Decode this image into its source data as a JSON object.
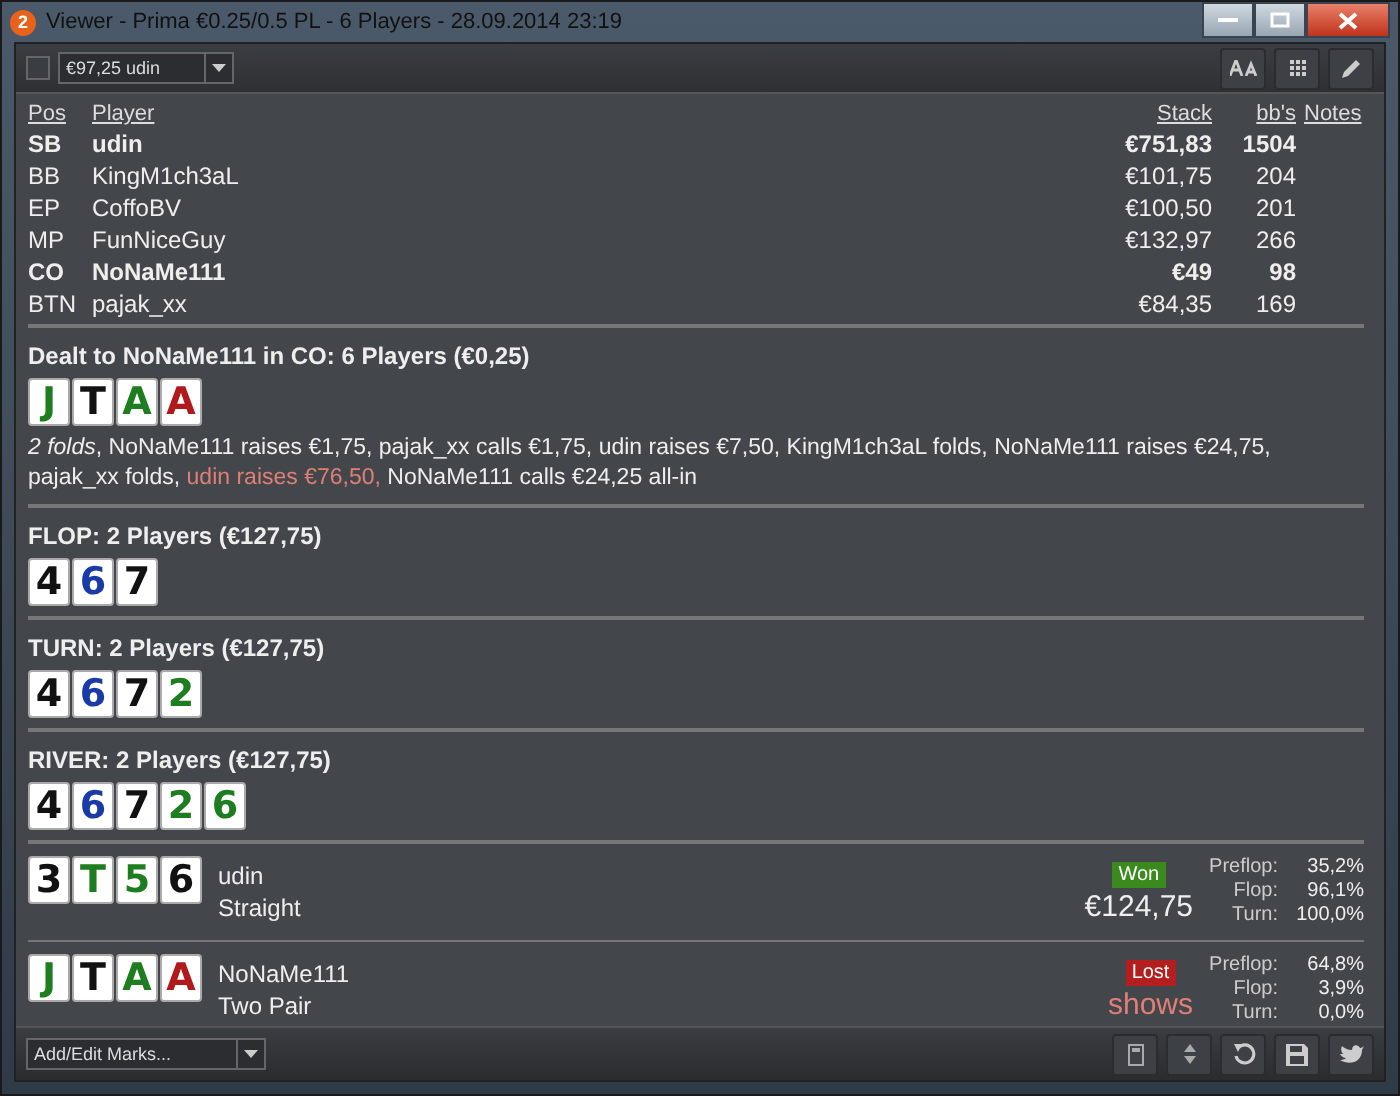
{
  "window": {
    "title": "Viewer - Prima €0.25/0.5 PL - 6 Players - 28.09.2014 23:19",
    "badge": "2"
  },
  "toolbar": {
    "checked": false,
    "hand_select": "€97,25 udin"
  },
  "players": {
    "columns": [
      "Pos",
      "Player",
      "Stack",
      "bb's",
      "Notes"
    ],
    "rows": [
      {
        "pos": "SB",
        "name": "udin",
        "stack": "€751,83",
        "bbs": "1504",
        "highlighted": true
      },
      {
        "pos": "BB",
        "name": "KingM1ch3aL",
        "stack": "€101,75",
        "bbs": "204",
        "highlighted": false
      },
      {
        "pos": "EP",
        "name": "CoffoBV",
        "stack": "€100,50",
        "bbs": "201",
        "highlighted": false
      },
      {
        "pos": "MP",
        "name": "FunNiceGuy",
        "stack": "€132,97",
        "bbs": "266",
        "highlighted": false
      },
      {
        "pos": "CO",
        "name": "NoNaMe111",
        "stack": "€49",
        "bbs": "98",
        "highlighted": true
      },
      {
        "pos": "BTN",
        "name": "pajak_xx",
        "stack": "€84,35",
        "bbs": "169",
        "highlighted": false
      }
    ]
  },
  "streets": [
    {
      "title": "Dealt to NoNaMe111 in CO: 6 Players (€0,25)",
      "cards": [
        {
          "rank": "J",
          "color": "#1e7d1e"
        },
        {
          "rank": "T",
          "color": "#111111"
        },
        {
          "rank": "A",
          "color": "#1e7d1e"
        },
        {
          "rank": "A",
          "color": "#b01a1a"
        }
      ],
      "actions": [
        {
          "text": "*2 folds*, NoNaMe111 raises €1,75, pajak_xx calls €1,75, udin raises €7,50, KingM1ch3aL folds, NoNaMe111 raises €24,75, pajak_xx folds,",
          "highlighted": false
        },
        {
          "text": "udin raises €76,50,",
          "highlighted": true
        },
        {
          "text": "NoNaMe111 calls €24,25 all-in",
          "highlighted": false
        }
      ]
    },
    {
      "title": "FLOP: 2 Players (€127,75)",
      "cards": [
        {
          "rank": "4",
          "color": "#111111"
        },
        {
          "rank": "6",
          "color": "#1a3aa8"
        },
        {
          "rank": "7",
          "color": "#111111"
        }
      ]
    },
    {
      "title": "TURN: 2 Players (€127,75)",
      "cards": [
        {
          "rank": "4",
          "color": "#111111"
        },
        {
          "rank": "6",
          "color": "#1a3aa8"
        },
        {
          "rank": "7",
          "color": "#111111"
        },
        {
          "rank": "2",
          "color": "#1e7d1e"
        }
      ]
    },
    {
      "title": "RIVER: 2 Players (€127,75)",
      "cards": [
        {
          "rank": "4",
          "color": "#111111"
        },
        {
          "rank": "6",
          "color": "#1a3aa8"
        },
        {
          "rank": "7",
          "color": "#111111"
        },
        {
          "rank": "2",
          "color": "#1e7d1e"
        },
        {
          "rank": "6",
          "color": "#1e7d1e"
        }
      ]
    }
  ],
  "showdown": [
    {
      "cards": [
        {
          "rank": "3",
          "color": "#111111"
        },
        {
          "rank": "T",
          "color": "#1e7d1e"
        },
        {
          "rank": "5",
          "color": "#1e7d1e"
        },
        {
          "rank": "6",
          "color": "#111111"
        }
      ],
      "name": "udin",
      "hand": "Straight",
      "result": {
        "kind": "won",
        "label": "Won"
      },
      "amount": "€124,75",
      "equity": [
        {
          "label": "Preflop:",
          "value": "35,2%"
        },
        {
          "label": "Flop:",
          "value": "96,1%"
        },
        {
          "label": "Turn:",
          "value": "100,0%"
        }
      ]
    },
    {
      "cards": [
        {
          "rank": "J",
          "color": "#1e7d1e"
        },
        {
          "rank": "T",
          "color": "#111111"
        },
        {
          "rank": "A",
          "color": "#1e7d1e"
        },
        {
          "rank": "A",
          "color": "#b01a1a"
        }
      ],
      "name": "NoNaMe111",
      "hand": "Two Pair",
      "result": {
        "kind": "lost",
        "label": "Lost"
      },
      "amount": "shows",
      "equity": [
        {
          "label": "Preflop:",
          "value": "64,8%"
        },
        {
          "label": "Flop:",
          "value": "3,9%"
        },
        {
          "label": "Turn:",
          "value": "0,0%"
        }
      ]
    }
  ],
  "bottom": {
    "marks_placeholder": "Add/Edit Marks..."
  }
}
